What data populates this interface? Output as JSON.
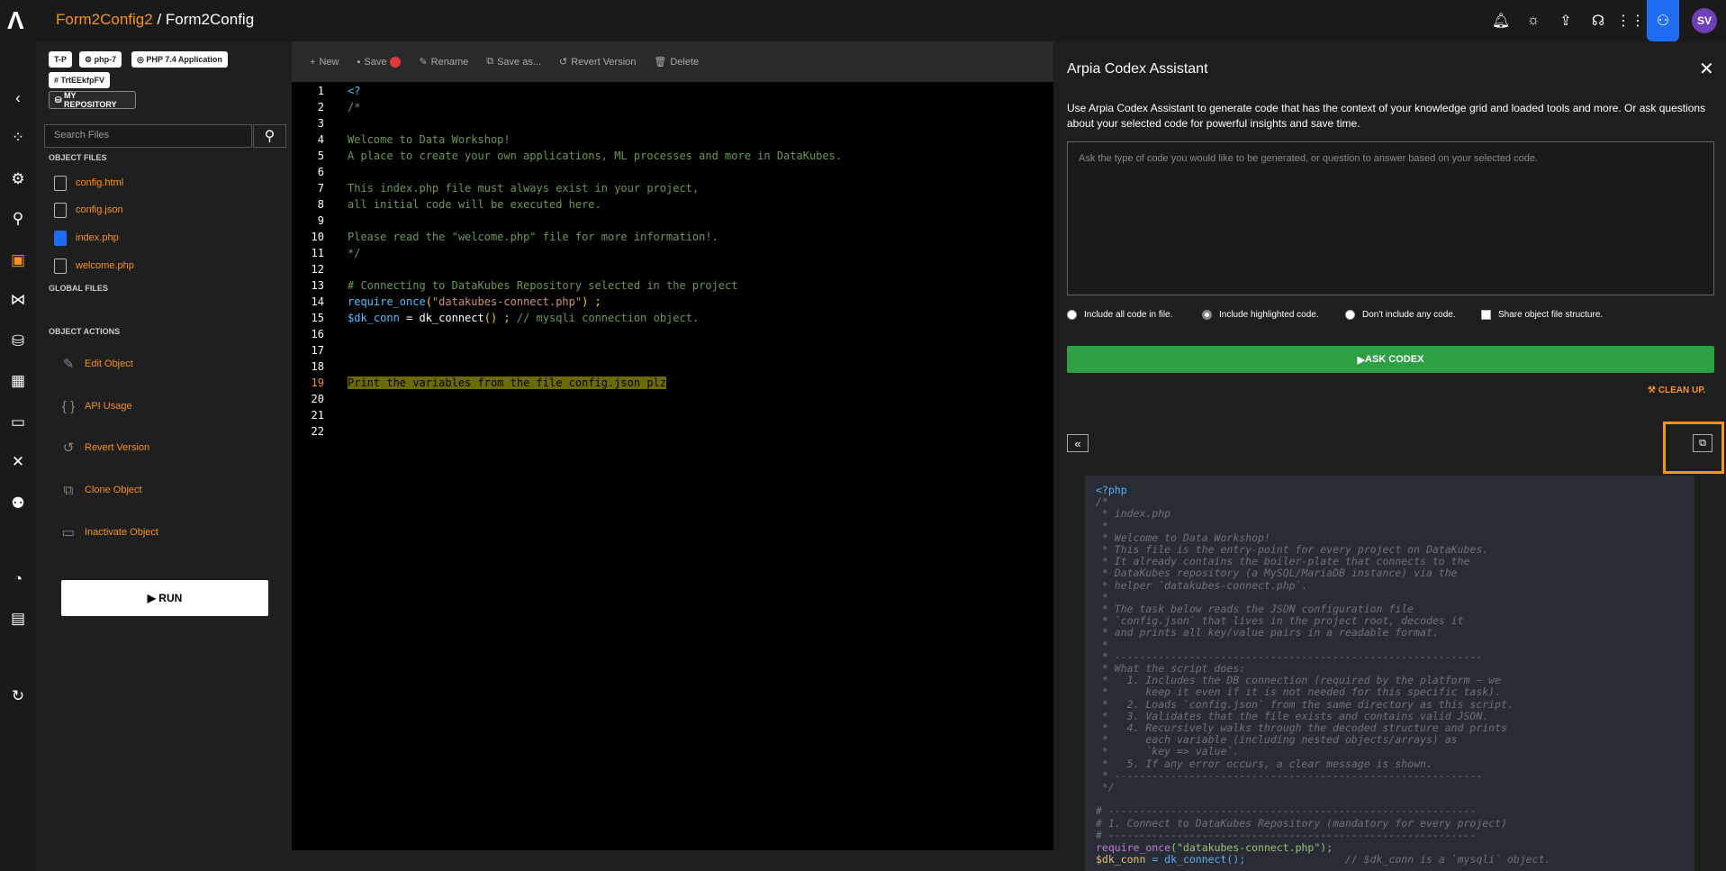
{
  "header": {
    "project": "Form2Config2",
    "separator": " / ",
    "object": "Form2Config",
    "avatar_initials": "SV",
    "icons": [
      "bell-icon",
      "lightbulb-icon",
      "share-icon",
      "support-icon",
      "apps-grid-icon",
      "assistant-icon"
    ]
  },
  "tags": {
    "t_p": "T-P",
    "php": "php-7",
    "app": "PHP 7.4 Application",
    "hash": "# TrtEEkfpFV",
    "repo": "MY REPOSITORY"
  },
  "files": {
    "search_placeholder": "Search Files",
    "object_files_label": "OBJECT FILES",
    "global_files_label": "GLOBAL FILES",
    "items": [
      "config.html",
      "config.json",
      "index.php",
      "welcome.php"
    ]
  },
  "actions": {
    "label": "OBJECT ACTIONS",
    "items": [
      "Edit Object",
      "API Usage",
      "Revert Version",
      "Clone Object",
      "Inactivate Object"
    ],
    "run": "RUN"
  },
  "toolbar": {
    "new": "New",
    "save": "Save",
    "rename": "Rename",
    "save_as": "Save as...",
    "revert": "Revert Version",
    "delete": "Delete"
  },
  "editor": {
    "line_numbers": [
      "1",
      "2",
      "3",
      "4",
      "5",
      "6",
      "7",
      "8",
      "9",
      "10",
      "11",
      "12",
      "13",
      "14",
      "15",
      "16",
      "17",
      "18",
      "19",
      "20",
      "21",
      "22"
    ],
    "l1": "<?",
    "l2": "/*",
    "l4": "Welcome to Data Workshop!",
    "l5": "A place to create your own applications, ML processes and more in DataKubes.",
    "l7": "This index.php file must always exist in your project,",
    "l8": "all initial code will be executed here.",
    "l10": "Please read the \"welcome.php\" file for more information!.",
    "l11": "*/",
    "l13": "# Connecting to DataKubes Repository selected in the project",
    "l14_fn": "require_once",
    "l14_open": "(",
    "l14_str": "\"datakubes-connect.php\"",
    "l14_close": ") ;",
    "l15_var": "$dk_conn",
    "l15_eq": " = ",
    "l15_fn": "dk_connect",
    "l15_paren": "()",
    "l15_semi": " ; ",
    "l15_com": "// mysqli connection object.",
    "l19": "Print the variables from the file config.json plz"
  },
  "assistant": {
    "title": "Arpia Codex Assistant",
    "description": "Use Arpia Codex Assistant to generate code that has the context of your knowledge grid and loaded tools and more. Or ask questions about your selected code for powerful insights and save time.",
    "placeholder": "Ask the type of code you would like to be generated, or question to answer based on your selected code.",
    "opt_all": "Include all code in file.",
    "opt_highlighted": "Include highlighted code.",
    "opt_none": "Don't include any code.",
    "opt_share": "Share object file structure.",
    "ask": "ASK CODEX",
    "cleanup": "CLEAN UP.",
    "response": [
      "<?php",
      "/*",
      " * index.php",
      " *",
      " * Welcome to Data Workshop!",
      " * This file is the entry-point for every project on DataKubes.",
      " * It already contains the boiler-plate that connects to the",
      " * DataKubes repository (a MySQL/MariaDB instance) via the",
      " * helper `datakubes-connect.php`.",
      " *",
      " * The task below reads the JSON configuration file",
      " * `config.json` that lives in the project root, decodes it",
      " * and prints all key/value pairs in a readable format.",
      " *",
      " * -----------------------------------------------------------",
      " * What the script does:",
      " *   1. Includes the DB connection (required by the platform – we",
      " *      keep it even if it is not needed for this specific task).",
      " *   2. Loads `config.json` from the same directory as this script.",
      " *   3. Validates that the file exists and contains valid JSON.",
      " *   4. Recursively walks through the decoded structure and prints",
      " *      each variable (including nested objects/arrays) as",
      " *      `key => value`.",
      " *   5. If any error occurs, a clear message is shown.",
      " * -----------------------------------------------------------",
      " */",
      "",
      "# -----------------------------------------------------------",
      "# 1. Connect to DataKubes Repository (mandatory for every project)",
      "# -----------------------------------------------------------"
    ],
    "resp_req_fn": "require_once",
    "resp_req_str": "(\"datakubes-connect.php\");",
    "resp_conn_var": "$dk_conn",
    "resp_conn_rest": " = ",
    "resp_conn_fn": "dk_connect",
    "resp_conn_end": "();",
    "resp_conn_com": "                // $dk_conn is a `mysqli` object."
  }
}
